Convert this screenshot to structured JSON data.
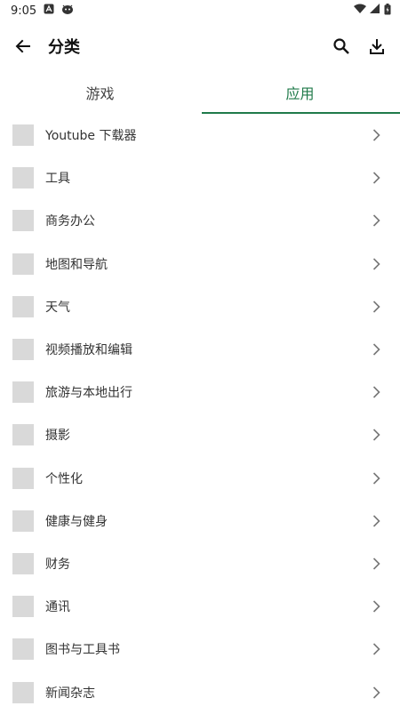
{
  "status_bar": {
    "time": "9:05"
  },
  "header": {
    "title": "分类"
  },
  "tabs": [
    {
      "label": "游戏",
      "active": false
    },
    {
      "label": "应用",
      "active": true
    }
  ],
  "categories": [
    "Youtube 下载器",
    "工具",
    "商务办公",
    "地图和导航",
    "天气",
    "视频播放和编辑",
    "旅游与本地出行",
    "摄影",
    "个性化",
    "健康与健身",
    "财务",
    "通讯",
    "图书与工具书",
    "新闻杂志"
  ],
  "colors": {
    "accent": "#1f7a4a",
    "thumb_placeholder": "#d9d9d9"
  }
}
